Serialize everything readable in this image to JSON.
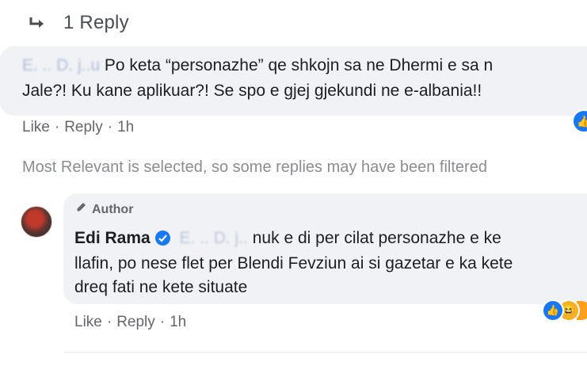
{
  "replies_toggle": {
    "icon": "reply-arrow-icon",
    "label": "1 Reply"
  },
  "comment1": {
    "author_name": "E. .. D. j..u",
    "line1": "Po keta “personazhe” qe shkojn sa ne Dhermi e sa n",
    "line2": "Jale?! Ku kane aplikuar?! Se spo e gjej gjekundi ne e-albania!!",
    "actions": {
      "like": "Like",
      "reply": "Reply",
      "separator": "·",
      "time": "1h"
    },
    "reaction_icon": "like-reaction-icon"
  },
  "filter_note": "Most Relevant is selected, so some replies may have been filtered",
  "reply1": {
    "badge": "Author",
    "badge_icon": "pen-icon",
    "author_name": "Edi Rama",
    "verified_icon": "verified-badge-icon",
    "mention": "E. .. D. j..",
    "line1": "nuk e di per cilat personazhe e ke",
    "line2": "llafin, po nese flet per Blendi Fevziun ai si gazetar e ka kete",
    "line3": "dreq fati ne kete situate",
    "actions": {
      "like": "Like",
      "reply": "Reply",
      "separator": "·",
      "time": "1h"
    },
    "reactions": [
      "like-reaction-icon",
      "haha-reaction-icon"
    ]
  },
  "colors": {
    "bubble": "#f0f2f5",
    "meta": "#65676b",
    "accent": "#1877f2"
  }
}
